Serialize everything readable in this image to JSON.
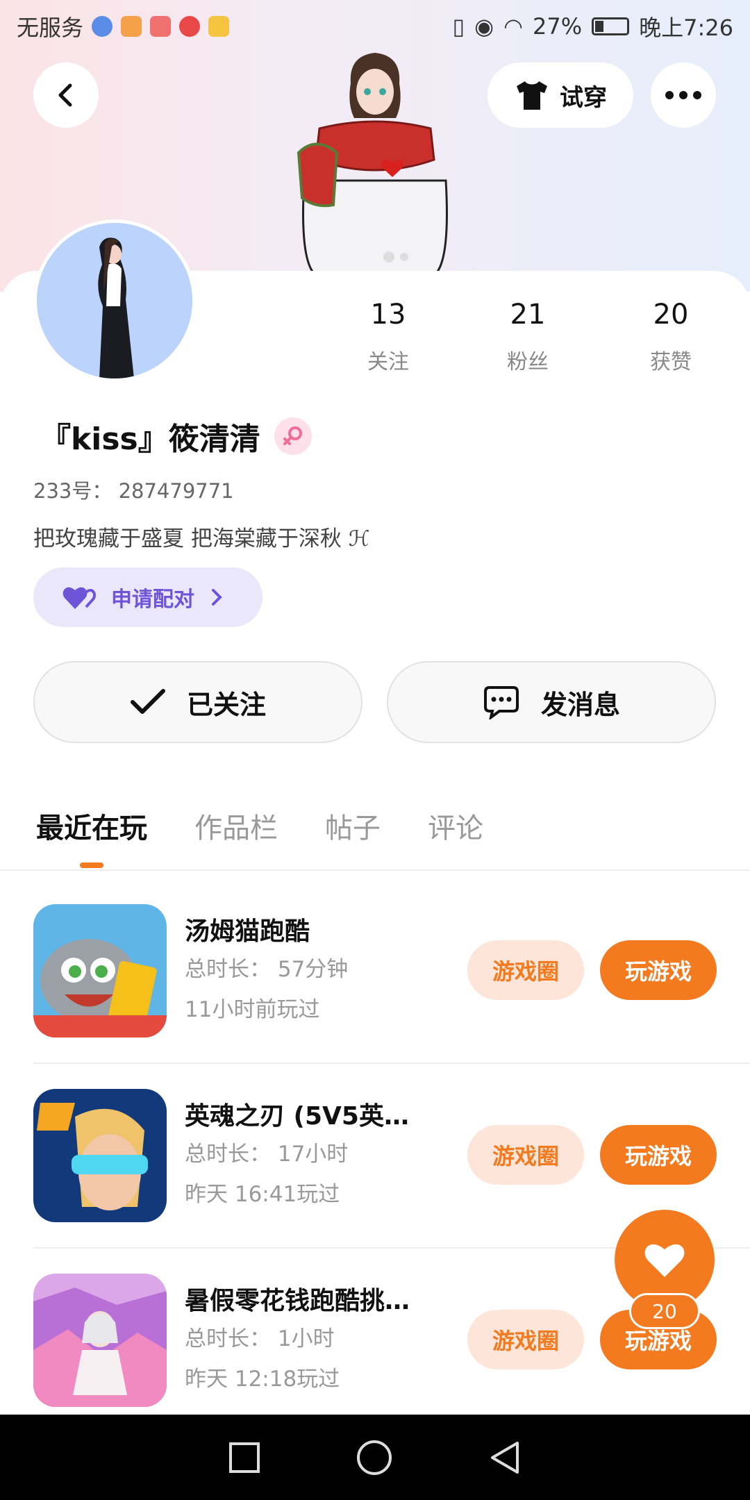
{
  "status_bar": {
    "carrier": "无服务",
    "battery": "27%",
    "time": "晚上7:26"
  },
  "header": {
    "back_icon": "back-arrow-icon",
    "try_on_label": "试穿",
    "more_icon": "more-dots-icon"
  },
  "profile": {
    "name": "『kiss』筱清清",
    "uid": "233号： 287479771",
    "bio": "把玫瑰藏于盛夏 把海棠藏于深秋 ℋ",
    "pair_label": "申请配对",
    "stats": [
      {
        "num": "13",
        "label": "关注"
      },
      {
        "num": "21",
        "label": "粉丝"
      },
      {
        "num": "20",
        "label": "获赞"
      }
    ]
  },
  "actions": {
    "followed_label": "已关注",
    "message_label": "发消息"
  },
  "tabs": [
    {
      "label": "最近在玩"
    },
    {
      "label": "作品栏"
    },
    {
      "label": "帖子"
    },
    {
      "label": "评论"
    }
  ],
  "games": [
    {
      "title": "汤姆猫跑酷",
      "duration": "总时长：  57分钟",
      "last_played": "11小时前玩过",
      "circle_label": "游戏圈",
      "play_label": "玩游戏"
    },
    {
      "title": "英魂之刃 (5V5英…",
      "duration": "总时长：  17小时",
      "last_played": "昨天  16:41玩过",
      "circle_label": "游戏圈",
      "play_label": "玩游戏"
    },
    {
      "title": "暑假零花钱跑酷挑…",
      "duration": "总时长：  1小时",
      "last_played": "昨天  12:18玩过",
      "circle_label": "游戏圈",
      "play_label": "玩游戏"
    }
  ],
  "like": {
    "count": "20"
  },
  "colors": {
    "accent": "#f47a1f",
    "accent_light": "#fde6d9",
    "pair_bg": "#ebe7fb",
    "pair_text": "#6d55d8",
    "avatar_bg": "#bcd4fc"
  }
}
